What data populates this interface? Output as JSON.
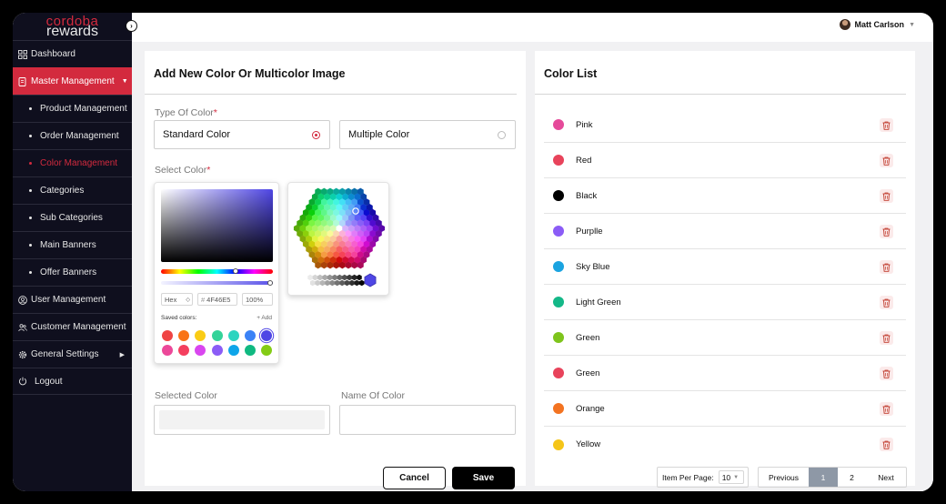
{
  "brand": {
    "line1": "cordoba",
    "line2": "rewards"
  },
  "user": {
    "name": "Matt Carlson"
  },
  "sidebar": {
    "items": [
      {
        "label": "Dashboard"
      },
      {
        "label": "Master Management"
      },
      {
        "label": "Product Management"
      },
      {
        "label": "Order Management"
      },
      {
        "label": "Color Management"
      },
      {
        "label": "Categories"
      },
      {
        "label": "Sub Categories"
      },
      {
        "label": "Main Banners"
      },
      {
        "label": "Offer Banners"
      },
      {
        "label": "User Management"
      },
      {
        "label": "Customer Management"
      },
      {
        "label": "General Settings"
      },
      {
        "label": "Logout"
      }
    ]
  },
  "form": {
    "title": "Add New Color Or Multicolor Image",
    "type_label": "Type Of Color",
    "required_mark": "*",
    "option_standard": "Standard Color",
    "option_multiple": "Multiple Color",
    "select_label": "Select Color",
    "selected_label": "Selected Color",
    "name_label": "Name Of Color",
    "name_value": "",
    "cancel": "Cancel",
    "save": "Save"
  },
  "picker": {
    "mode": "Hex",
    "hex": "4F46E5",
    "hex_prefix": "#",
    "alpha": "100%",
    "hue_position": 0.7,
    "saved_label": "Saved colors:",
    "add_label": "+ Add",
    "current_color": "#4F46E5",
    "swatches": [
      "#ef4444",
      "#f97316",
      "#facc15",
      "#34d399",
      "#2dd4bf",
      "#3b82f6",
      "#4F46E5",
      "#ec4899",
      "#f43f5e",
      "#d946ef",
      "#8b5cf6",
      "#0ea5e9",
      "#10b981",
      "#84cc16"
    ]
  },
  "list": {
    "title": "Color List",
    "colors": [
      {
        "name": "Pink",
        "hex": "#e54a9a"
      },
      {
        "name": "Red",
        "hex": "#e8435b"
      },
      {
        "name": "Black",
        "hex": "#000000"
      },
      {
        "name": "Purplle",
        "hex": "#8b5cf6"
      },
      {
        "name": "Sky Blue",
        "hex": "#1aa3e0"
      },
      {
        "name": "Light Green",
        "hex": "#14b888"
      },
      {
        "name": "Green",
        "hex": "#7ec41c"
      },
      {
        "name": "Green",
        "hex": "#e8435b"
      },
      {
        "name": "Orange",
        "hex": "#f37321"
      },
      {
        "name": "Yellow",
        "hex": "#f5c518"
      }
    ],
    "per_page_label": "Item Per Page:",
    "per_page": "10",
    "prev": "Previous",
    "page1": "1",
    "page2": "2",
    "next": "Next"
  }
}
